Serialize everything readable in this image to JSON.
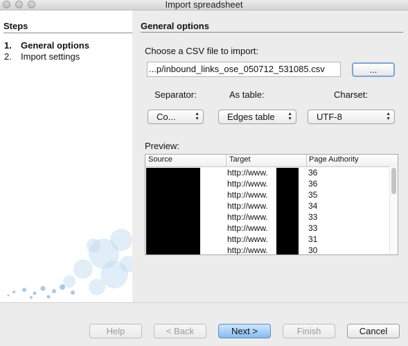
{
  "window": {
    "title": "Import spreadsheet"
  },
  "steps": {
    "heading": "Steps",
    "items": [
      {
        "num": "1.",
        "label": "General options",
        "active": true
      },
      {
        "num": "2.",
        "label": "Import settings",
        "active": false
      }
    ]
  },
  "panel": {
    "title": "General options",
    "file_label": "Choose a CSV file to import:",
    "file_value": "...p/inbound_links_ose_050712_531085.csv",
    "browse_label": "...",
    "separator_label": "Separator:",
    "separator_value": "Co...",
    "as_table_label": "As table:",
    "as_table_value": "Edges table",
    "charset_label": "Charset:",
    "charset_value": "UTF-8",
    "preview_label": "Preview:"
  },
  "preview": {
    "columns": [
      "Source",
      "Target",
      "Page Authority"
    ],
    "rows": [
      {
        "target": "http://www.",
        "authority": "36"
      },
      {
        "target": "http://www.",
        "authority": "36"
      },
      {
        "target": "http://www.",
        "authority": "35"
      },
      {
        "target": "http://www.",
        "authority": "34"
      },
      {
        "target": "http://www.",
        "authority": "33"
      },
      {
        "target": "http://www.",
        "authority": "33"
      },
      {
        "target": "http://www.",
        "authority": "31"
      },
      {
        "target": "http://www.",
        "authority": "30"
      }
    ]
  },
  "buttons": {
    "help": "Help",
    "back": "< Back",
    "next": "Next >",
    "finish": "Finish",
    "cancel": "Cancel"
  },
  "colors": {
    "primary_button": "#86bbf0",
    "focus_ring": "#7aa7d8",
    "redaction": "#000000"
  }
}
